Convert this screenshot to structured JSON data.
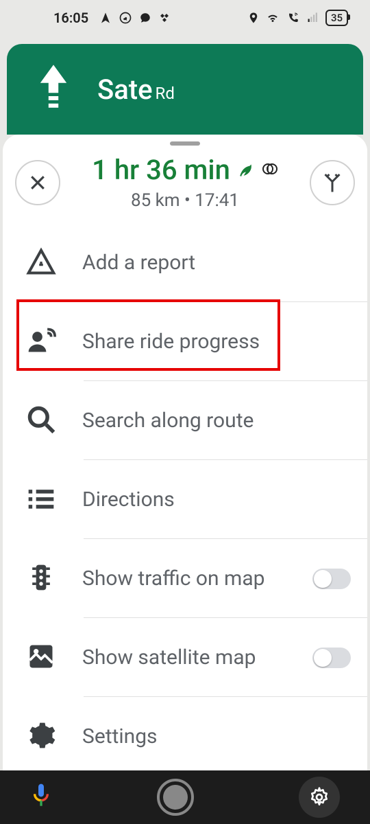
{
  "status": {
    "time": "16:05",
    "battery": "35"
  },
  "banner": {
    "road_main": "Sate",
    "road_suffix": "Rd"
  },
  "trip": {
    "duration": "1 hr 36 min",
    "distance": "85 km",
    "eta": "17:41"
  },
  "menu": {
    "add_report": "Add a report",
    "share_ride": "Share ride progress",
    "search_route": "Search along route",
    "directions": "Directions",
    "show_traffic": "Show traffic on map",
    "show_satellite": "Show satellite map",
    "settings": "Settings"
  },
  "toggles": {
    "traffic": false,
    "satellite": false
  }
}
